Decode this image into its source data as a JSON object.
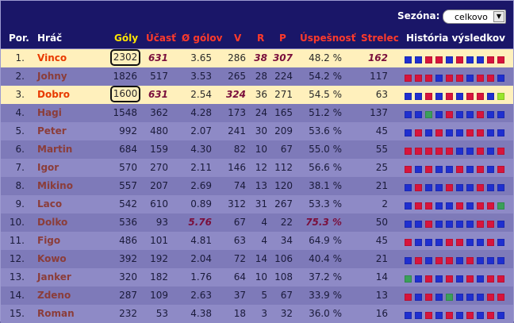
{
  "season": {
    "label": "Sezóna:",
    "value": "celkovo"
  },
  "columns": {
    "rank": "Por.",
    "player": "Hráč",
    "goals": "Góly",
    "matches": "Účasť",
    "avg_goals": "Ø gólov",
    "wins": "V",
    "draws": "R",
    "losses": "P",
    "success": "Úspešnosť",
    "scorer": "Strelec",
    "history": "História výsledkov"
  },
  "colors": {
    "win": "#1f2fd0",
    "loss": "#d8143c",
    "draw": "#3aa05a",
    "lime": "#9ae62a"
  },
  "rows": [
    {
      "rank": "1.",
      "name": "Vinco",
      "goals": "2302",
      "matches": "631",
      "avg": "3.65",
      "w": "286",
      "d": "38",
      "l": "307",
      "pct": "48.2 %",
      "scorer": "162",
      "hist": [
        "b",
        "b",
        "r",
        "r",
        "b",
        "r",
        "b",
        "b",
        "r",
        "r"
      ],
      "hl": true,
      "boxed": true
    },
    {
      "rank": "2.",
      "name": "Johny",
      "goals": "1826",
      "matches": "517",
      "avg": "3.53",
      "w": "265",
      "d": "28",
      "l": "224",
      "pct": "54.2 %",
      "scorer": "117",
      "hist": [
        "r",
        "r",
        "r",
        "b",
        "r",
        "r",
        "b",
        "r",
        "r",
        "b"
      ]
    },
    {
      "rank": "3.",
      "name": "Dobro",
      "goals": "1600",
      "matches": "631",
      "avg": "2.54",
      "w": "324",
      "d": "36",
      "l": "271",
      "pct": "54.5 %",
      "scorer": "63",
      "hist": [
        "b",
        "b",
        "r",
        "b",
        "r",
        "b",
        "r",
        "r",
        "b",
        "l"
      ],
      "hl": true,
      "boxed": true
    },
    {
      "rank": "4.",
      "name": "Hagi",
      "goals": "1548",
      "matches": "362",
      "avg": "4.28",
      "w": "173",
      "d": "24",
      "l": "165",
      "pct": "51.2 %",
      "scorer": "137",
      "hist": [
        "b",
        "b",
        "g",
        "b",
        "r",
        "b",
        "b",
        "r",
        "b",
        "b"
      ]
    },
    {
      "rank": "5.",
      "name": "Peter",
      "goals": "992",
      "matches": "480",
      "avg": "2.07",
      "w": "241",
      "d": "30",
      "l": "209",
      "pct": "53.6 %",
      "scorer": "45",
      "hist": [
        "b",
        "r",
        "b",
        "r",
        "b",
        "b",
        "r",
        "r",
        "b",
        "b"
      ]
    },
    {
      "rank": "6.",
      "name": "Martin",
      "goals": "684",
      "matches": "159",
      "avg": "4.30",
      "w": "82",
      "d": "10",
      "l": "67",
      "pct": "55.0 %",
      "scorer": "55",
      "hist": [
        "r",
        "r",
        "r",
        "r",
        "r",
        "b",
        "b",
        "r",
        "b",
        "r"
      ]
    },
    {
      "rank": "7.",
      "name": "Igor",
      "goals": "570",
      "matches": "270",
      "avg": "2.11",
      "w": "146",
      "d": "12",
      "l": "112",
      "pct": "56.6 %",
      "scorer": "25",
      "hist": [
        "r",
        "b",
        "r",
        "b",
        "b",
        "r",
        "b",
        "r",
        "b",
        "r"
      ]
    },
    {
      "rank": "8.",
      "name": "Mikino",
      "goals": "557",
      "matches": "207",
      "avg": "2.69",
      "w": "74",
      "d": "13",
      "l": "120",
      "pct": "38.1 %",
      "scorer": "21",
      "hist": [
        "b",
        "r",
        "b",
        "b",
        "r",
        "b",
        "b",
        "r",
        "b",
        "b"
      ]
    },
    {
      "rank": "9.",
      "name": "Laco",
      "goals": "542",
      "matches": "610",
      "avg": "0.89",
      "w": "312",
      "d": "31",
      "l": "267",
      "pct": "53.3 %",
      "scorer": "2",
      "hist": [
        "b",
        "r",
        "r",
        "b",
        "b",
        "r",
        "b",
        "r",
        "r",
        "g"
      ]
    },
    {
      "rank": "10.",
      "name": "Dolko",
      "goals": "536",
      "matches": "93",
      "avg": "5.76",
      "w": "67",
      "d": "4",
      "l": "22",
      "pct": "75.3 %",
      "scorer": "50",
      "hist": [
        "b",
        "b",
        "r",
        "b",
        "b",
        "b",
        "b",
        "r",
        "r",
        "b"
      ],
      "bold_avg": true,
      "bold_pct": true
    },
    {
      "rank": "11.",
      "name": "Figo",
      "goals": "486",
      "matches": "101",
      "avg": "4.81",
      "w": "63",
      "d": "4",
      "l": "34",
      "pct": "64.9 %",
      "scorer": "45",
      "hist": [
        "r",
        "b",
        "b",
        "b",
        "r",
        "r",
        "b",
        "b",
        "r",
        "b"
      ]
    },
    {
      "rank": "12.",
      "name": "Kowo",
      "goals": "392",
      "matches": "192",
      "avg": "2.04",
      "w": "72",
      "d": "14",
      "l": "106",
      "pct": "40.4 %",
      "scorer": "21",
      "hist": [
        "b",
        "r",
        "b",
        "r",
        "r",
        "b",
        "r",
        "b",
        "b",
        "b"
      ]
    },
    {
      "rank": "13.",
      "name": "Janker",
      "goals": "320",
      "matches": "182",
      "avg": "1.76",
      "w": "64",
      "d": "10",
      "l": "108",
      "pct": "37.2 %",
      "scorer": "14",
      "hist": [
        "g",
        "b",
        "r",
        "b",
        "r",
        "b",
        "r",
        "b",
        "r",
        "r"
      ]
    },
    {
      "rank": "14.",
      "name": "Zdeno",
      "goals": "287",
      "matches": "109",
      "avg": "2.63",
      "w": "37",
      "d": "5",
      "l": "67",
      "pct": "33.9 %",
      "scorer": "13",
      "hist": [
        "r",
        "b",
        "r",
        "b",
        "g",
        "b",
        "b",
        "b",
        "r",
        "r"
      ]
    },
    {
      "rank": "15.",
      "name": "Roman",
      "goals": "232",
      "matches": "53",
      "avg": "4.38",
      "w": "18",
      "d": "3",
      "l": "32",
      "pct": "36.0 %",
      "scorer": "16",
      "hist": [
        "b",
        "b",
        "r",
        "b",
        "r",
        "b",
        "r",
        "b",
        "r",
        "b"
      ]
    }
  ]
}
